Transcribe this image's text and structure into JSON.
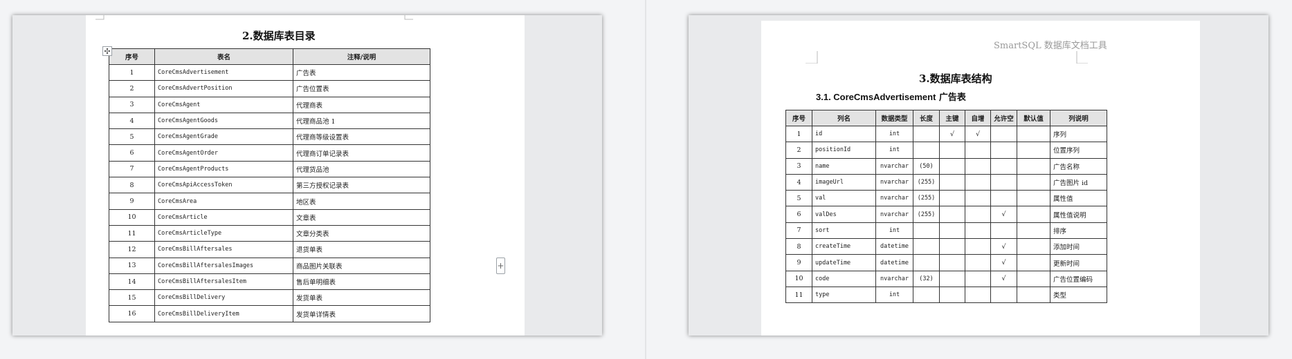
{
  "left_page": {
    "title": "2.数据库表目录",
    "columns": [
      "序号",
      "表名",
      "注释/说明"
    ],
    "rows": [
      [
        "1",
        "CoreCmsAdvertisement",
        "广告表"
      ],
      [
        "2",
        "CoreCmsAdvertPosition",
        "广告位置表"
      ],
      [
        "3",
        "CoreCmsAgent",
        "代理商表"
      ],
      [
        "4",
        "CoreCmsAgentGoods",
        "代理商品池 1"
      ],
      [
        "5",
        "CoreCmsAgentGrade",
        "代理商等级设置表"
      ],
      [
        "6",
        "CoreCmsAgentOrder",
        "代理商订单记录表"
      ],
      [
        "7",
        "CoreCmsAgentProducts",
        "代理货品池"
      ],
      [
        "8",
        "CoreCmsApiAccessToken",
        "第三方授权记录表"
      ],
      [
        "9",
        "CoreCmsArea",
        "地区表"
      ],
      [
        "10",
        "CoreCmsArticle",
        "文章表"
      ],
      [
        "11",
        "CoreCmsArticleType",
        "文章分类表"
      ],
      [
        "12",
        "CoreCmsBillAftersales",
        "退货单表"
      ],
      [
        "13",
        "CoreCmsBillAftersalesImages",
        "商品图片关联表"
      ],
      [
        "14",
        "CoreCmsBillAftersalesItem",
        "售后单明细表"
      ],
      [
        "15",
        "CoreCmsBillDelivery",
        "发货单表"
      ],
      [
        "16",
        "CoreCmsBillDeliveryItem",
        "发货单详情表"
      ]
    ]
  },
  "right_page": {
    "header_text": "SmartSQL 数据库文档工具",
    "title": "3.数据库表结构",
    "section_en": "3.1. CoreCmsAdvertisement",
    "section_cn": " 广告表",
    "columns": [
      "序号",
      "列名",
      "数据类型",
      "长度",
      "主键",
      "自增",
      "允许空",
      "默认值",
      "列说明"
    ],
    "rows": [
      [
        "1",
        "id",
        "int",
        "",
        "√",
        "√",
        "",
        "",
        "序列"
      ],
      [
        "2",
        "positionId",
        "int",
        "",
        "",
        "",
        "",
        "",
        "位置序列"
      ],
      [
        "3",
        "name",
        "nvarchar",
        "(50)",
        "",
        "",
        "",
        "",
        "广告名称"
      ],
      [
        "4",
        "imageUrl",
        "nvarchar",
        "(255)",
        "",
        "",
        "",
        "",
        "广告图片 id"
      ],
      [
        "5",
        "val",
        "nvarchar",
        "(255)",
        "",
        "",
        "",
        "",
        "属性值"
      ],
      [
        "6",
        "valDes",
        "nvarchar",
        "(255)",
        "",
        "",
        "√",
        "",
        "属性值说明"
      ],
      [
        "7",
        "sort",
        "int",
        "",
        "",
        "",
        "",
        "",
        "排序"
      ],
      [
        "8",
        "createTime",
        "datetime",
        "",
        "",
        "",
        "√",
        "",
        "添加时间"
      ],
      [
        "9",
        "updateTime",
        "datetime",
        "",
        "",
        "",
        "√",
        "",
        "更新时间"
      ],
      [
        "10",
        "code",
        "nvarchar",
        "(32)",
        "",
        "",
        "√",
        "",
        "广告位置编码"
      ],
      [
        "11",
        "type",
        "int",
        "",
        "",
        "",
        "",
        "",
        "类型"
      ]
    ]
  },
  "icons": {
    "move_handle": "move-icon",
    "add_row": "plus-icon",
    "move_glyph": "✣",
    "add_glyph": "+"
  }
}
